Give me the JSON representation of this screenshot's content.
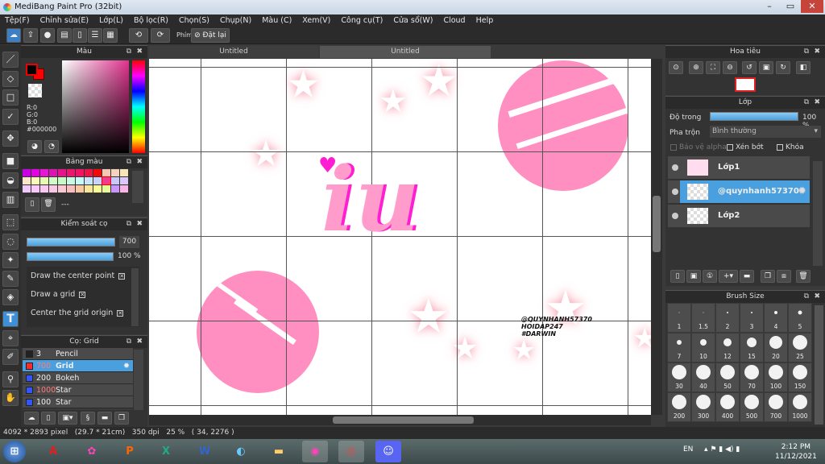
{
  "window": {
    "title": "MediBang Paint Pro (32bit)"
  },
  "menu": [
    "Tệp(F)",
    "Chỉnh sửa(E)",
    "Lớp(L)",
    "Bộ lọc(R)",
    "Chọn(S)",
    "Chụp(N)",
    "Màu (C)",
    "Xem(V)",
    "Công cụ(T)",
    "Cửa sổ(W)",
    "Cloud",
    "Help"
  ],
  "toolbar": {
    "shortcut_label": "Phím",
    "reset_label": "Đặt lại"
  },
  "tabs": [
    "Untitled",
    "Untitled"
  ],
  "color_panel": {
    "title": "Màu",
    "r": "R:0",
    "g": "G:0",
    "b": "B:0",
    "hex": "#000000",
    "primary": "#000000",
    "secondary": "#ff0000"
  },
  "palette_panel": {
    "title": "Bảng màu",
    "name": "---",
    "colors": [
      "#c800e6",
      "#e600e6",
      "#e619d2",
      "#dc14b4",
      "#e6148c",
      "#f0146e",
      "#f01464",
      "#f01446",
      "#f00a0a",
      "#f5c8b4",
      "#f5d2be",
      "#fae6b4",
      "#fae6c8",
      "#fafab4",
      "#e6fab4",
      "#d2fac8",
      "#c8fac8",
      "#c8fae6",
      "#c8fafa",
      "#c8e6fa",
      "#c8d2fa",
      "#f03c8c",
      "#c8c8fa",
      "#dcc8fa",
      "#f0c8fa",
      "#fac8fa",
      "#fac8f0",
      "#fac8e6",
      "#fac8d2",
      "#fabebe",
      "#fac8a0",
      "#fae696",
      "#fafa96",
      "#e6fa96",
      "#c896fa",
      "#fab4e6"
    ]
  },
  "brush_control": {
    "title": "Kiểm soát cọ",
    "size": "700",
    "opacity": "100 %",
    "opacity_value": 100,
    "options": [
      {
        "label": "Draw the center point",
        "checked": true
      },
      {
        "label": "Draw a grid",
        "checked": true
      },
      {
        "label": "Center the grid origin",
        "checked": true
      }
    ]
  },
  "brush_panel": {
    "title": "Cọ: Grid",
    "items": [
      {
        "size": "3",
        "name": "Pencil",
        "color": "#222222",
        "selected": false
      },
      {
        "size": "700",
        "name": "Grid",
        "color": "#ff2a2a",
        "selected": true
      },
      {
        "size": "200",
        "name": "Bokeh",
        "color": "#3355ff",
        "selected": false
      },
      {
        "size": "1000",
        "name": "Star",
        "color": "#3355ff",
        "selected": false
      },
      {
        "size": "100",
        "name": "Star",
        "color": "#3355ff",
        "selected": false
      }
    ]
  },
  "canvas": {
    "watermark": [
      "@QUYNHANH57370",
      "HOIDAP247",
      "#DARWIN"
    ],
    "art_text": "iu"
  },
  "navigator": {
    "title": "Hoa tiêu"
  },
  "layer_panel": {
    "title": "Lớp",
    "opacity_label": "Độ trong",
    "opacity": "100 %",
    "opacity_value": 100,
    "blend_label": "Pha trộn",
    "blend": "Bình thường",
    "protect_alpha": "Bảo vệ alpha",
    "clipping": "Xén bớt",
    "lock": "Khóa",
    "layers": [
      {
        "name": "Lớp1",
        "selected": false
      },
      {
        "name": "@quynhanh57370",
        "selected": true
      },
      {
        "name": "Lớp2",
        "selected": false
      }
    ]
  },
  "brush_size": {
    "title": "Brush Size",
    "sizes": [
      "1",
      "1.5",
      "2",
      "3",
      "4",
      "5",
      "7",
      "10",
      "12",
      "15",
      "20",
      "25",
      "30",
      "40",
      "50",
      "70",
      "100",
      "150",
      "200",
      "300",
      "400",
      "500",
      "700",
      "1000"
    ]
  },
  "status": {
    "text": "4092 * 2893 pixel   (29.7 * 21cm)   350 dpi   25 %   ( 34, 2276 )"
  },
  "taskbar": {
    "lang": "EN",
    "time": "2:12 PM",
    "date": "11/12/2021"
  }
}
